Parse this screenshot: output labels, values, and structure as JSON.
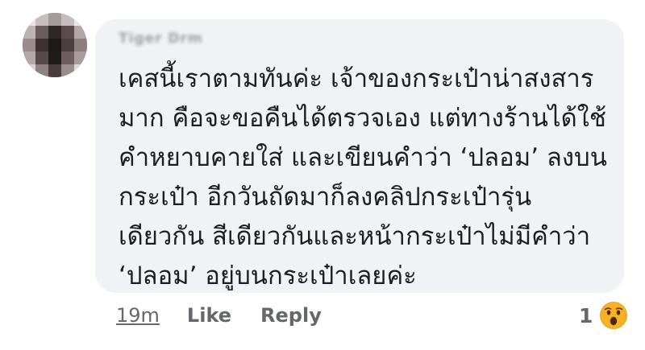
{
  "comment": {
    "author": "Tiger Drm",
    "text_lines": [
      "เคสนี้เราตามทันค่ะ เจ้าของกระเป๋าน่าสงสาร",
      "มาก คือจะขอคืนได้ตรวจเอง แต่ทางร้านได้ใช้",
      "คำหยาบคายใส่ และเขียนคำว่า ‘ปลอม’ ลงบน",
      "กระเป๋า อีกวันถัดมาก็ลงคลิปกระเป๋ารุ่น",
      "เดียวกัน สีเดียวกันและหน้ากระเป๋าไม่มีคำว่า",
      "‘ปลอม’ อยู่บนกระเป๋าเลยค่ะ"
    ],
    "timestamp": "19m",
    "like_label": "Like",
    "reply_label": "Reply",
    "reaction_count": "1",
    "reaction_icon": "wow-emoji-icon"
  },
  "colors": {
    "bubble_bg": "#f0f2f5",
    "text": "#1c1e21",
    "meta_text": "#65676b",
    "wow_yellow": "#f7b125"
  }
}
